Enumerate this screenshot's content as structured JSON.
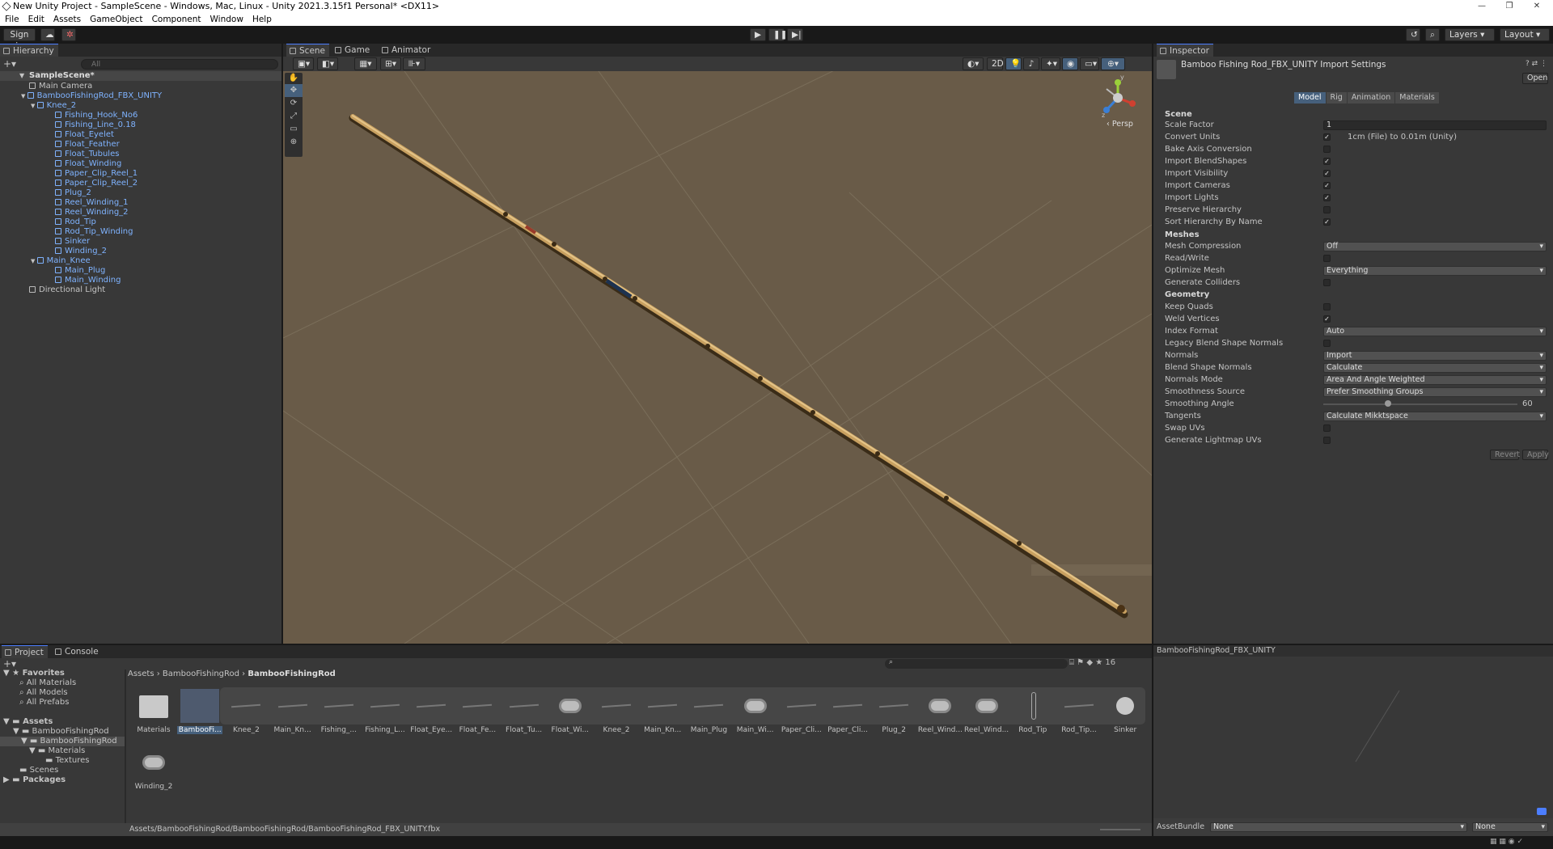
{
  "window": {
    "title": "New Unity Project - SampleScene - Windows, Mac, Linux - Unity 2021.3.15f1 Personal* <DX11>"
  },
  "menu": [
    "File",
    "Edit",
    "Assets",
    "GameObject",
    "Component",
    "Window",
    "Help"
  ],
  "toolbar": {
    "sign_in": "Sign in",
    "layers": "Layers",
    "layout": "Layout"
  },
  "hierarchy": {
    "tab": "Hierarchy",
    "search_placeholder": "All",
    "scene": "SampleScene*",
    "items": [
      {
        "label": "Main Camera",
        "depth": 1,
        "prefab": false
      },
      {
        "label": "BambooFishingRod_FBX_UNITY",
        "depth": 1,
        "prefab": true
      },
      {
        "label": "Knee_2",
        "depth": 2,
        "prefab": true
      },
      {
        "label": "Fishing_Hook_No6",
        "depth": 3,
        "prefab": true
      },
      {
        "label": "Fishing_Line_0.18",
        "depth": 3,
        "prefab": true
      },
      {
        "label": "Float_Eyelet",
        "depth": 3,
        "prefab": true
      },
      {
        "label": "Float_Feather",
        "depth": 3,
        "prefab": true
      },
      {
        "label": "Float_Tubules",
        "depth": 3,
        "prefab": true
      },
      {
        "label": "Float_Winding",
        "depth": 3,
        "prefab": true
      },
      {
        "label": "Paper_Clip_Reel_1",
        "depth": 3,
        "prefab": true
      },
      {
        "label": "Paper_Clip_Reel_2",
        "depth": 3,
        "prefab": true
      },
      {
        "label": "Plug_2",
        "depth": 3,
        "prefab": true
      },
      {
        "label": "Reel_Winding_1",
        "depth": 3,
        "prefab": true
      },
      {
        "label": "Reel_Winding_2",
        "depth": 3,
        "prefab": true
      },
      {
        "label": "Rod_Tip",
        "depth": 3,
        "prefab": true
      },
      {
        "label": "Rod_Tip_Winding",
        "depth": 3,
        "prefab": true
      },
      {
        "label": "Sinker",
        "depth": 3,
        "prefab": true
      },
      {
        "label": "Winding_2",
        "depth": 3,
        "prefab": true
      },
      {
        "label": "Main_Knee",
        "depth": 2,
        "prefab": true
      },
      {
        "label": "Main_Plug",
        "depth": 3,
        "prefab": true
      },
      {
        "label": "Main_Winding",
        "depth": 3,
        "prefab": true
      },
      {
        "label": "Directional Light",
        "depth": 1,
        "prefab": false
      }
    ]
  },
  "scene": {
    "tabs": [
      "Scene",
      "Game",
      "Animator"
    ],
    "mode_2d": "2D",
    "gizmo_label": "Persp",
    "axis_y": "y",
    "axis_z": "z"
  },
  "inspector": {
    "tab": "Inspector",
    "title": "Bamboo Fishing Rod_FBX_UNITY Import Settings",
    "open_button": "Open",
    "subtabs": [
      "Model",
      "Rig",
      "Animation",
      "Materials"
    ],
    "section_scene": "Scene",
    "section_meshes": "Meshes",
    "section_geometry": "Geometry",
    "scale_factor_label": "Scale Factor",
    "scale_factor_value": "1",
    "convert_units_label": "Convert Units",
    "convert_units_note": "1cm (File) to 0.01m (Unity)",
    "bake_axis_label": "Bake Axis Conversion",
    "import_blend_label": "Import BlendShapes",
    "import_visibility_label": "Import Visibility",
    "import_cameras_label": "Import Cameras",
    "import_lights_label": "Import Lights",
    "preserve_hierarchy_label": "Preserve Hierarchy",
    "sort_hierarchy_label": "Sort Hierarchy By Name",
    "mesh_compression_label": "Mesh Compression",
    "mesh_compression_value": "Off",
    "read_write_label": "Read/Write",
    "optimize_mesh_label": "Optimize Mesh",
    "optimize_mesh_value": "Everything",
    "generate_colliders_label": "Generate Colliders",
    "keep_quads_label": "Keep Quads",
    "weld_vertices_label": "Weld Vertices",
    "index_format_label": "Index Format",
    "index_format_value": "Auto",
    "legacy_blend_label": "Legacy Blend Shape Normals",
    "normals_label": "Normals",
    "normals_value": "Import",
    "blend_normals_label": "Blend Shape Normals",
    "blend_normals_value": "Calculate",
    "normals_mode_label": "Normals Mode",
    "normals_mode_value": "Area And Angle Weighted",
    "smoothness_source_label": "Smoothness Source",
    "smoothness_source_value": "Prefer Smoothing Groups",
    "smoothing_angle_label": "Smoothing Angle",
    "smoothing_angle_value": "60",
    "smoothing_angle_fraction": 0.333,
    "tangents_label": "Tangents",
    "tangents_value": "Calculate Mikktspace",
    "swap_uvs_label": "Swap UVs",
    "generate_lightmap_label": "Generate Lightmap UVs",
    "revert_button": "Revert",
    "apply_button": "Apply"
  },
  "project": {
    "tabs": [
      "Project",
      "Console"
    ],
    "favorites": "Favorites",
    "fav_items": [
      "All Materials",
      "All Models",
      "All Prefabs"
    ],
    "assets_root": "Assets",
    "tree": [
      "BambooFishingRod",
      "BambooFishingRod",
      "Materials",
      "Textures",
      "Scenes"
    ],
    "packages": "Packages",
    "breadcrumb": [
      "Assets",
      "BambooFishingRod",
      "BambooFishingRod"
    ],
    "asset_count": "16",
    "grid_items": [
      "Materials",
      "BambooFi...",
      "Knee_2",
      "Main_Kn...",
      "Fishing_...",
      "Fishing_L...",
      "Float_Eye...",
      "Float_Fe...",
      "Float_Tu...",
      "Float_Wi...",
      "Knee_2",
      "Main_Kn...",
      "Main_Plug",
      "Main_Wi...",
      "Paper_Cli...",
      "Paper_Cli...",
      "Plug_2",
      "Reel_Wind...",
      "Reel_Wind...",
      "Rod_Tip",
      "Rod_Tip...",
      "Sinker"
    ],
    "grid_row2": [
      "Winding_2"
    ],
    "path": "Assets/BambooFishingRod/BambooFishingRod/BambooFishingRod_FBX_UNITY.fbx"
  },
  "preview": {
    "title": "BambooFishingRod_FBX_UNITY",
    "assetbundle_label": "AssetBundle",
    "assetbundle_value": "None",
    "variant_value": "None"
  },
  "colors": {
    "accent": "#4c7eff",
    "scene_bg": "#695b48",
    "panel": "#383838",
    "prefab_text": "#7fb3ff"
  }
}
